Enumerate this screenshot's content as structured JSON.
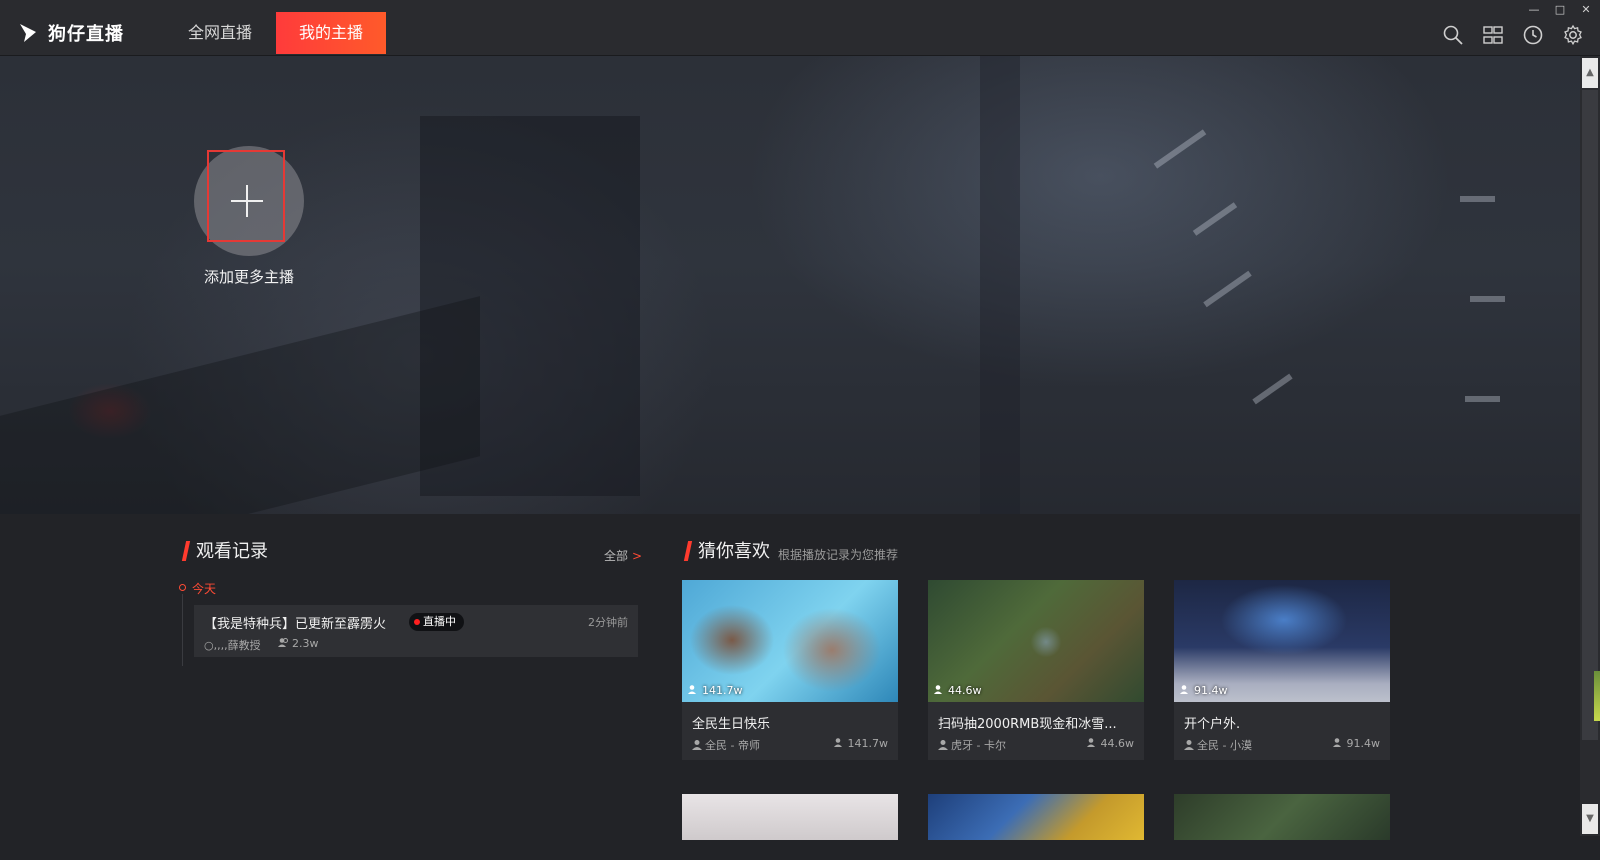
{
  "app": {
    "name": "狗仔直播"
  },
  "nav": {
    "tabs": [
      "全网直播",
      "我的主播"
    ],
    "active_index": 1
  },
  "window_controls": {
    "minimize": "—",
    "maximize": "□",
    "close": "✕"
  },
  "toolbar": {
    "icons": [
      "search-icon",
      "grid-icon",
      "clock-icon",
      "gear-icon"
    ]
  },
  "hero": {
    "add_label": "添加更多主播"
  },
  "history": {
    "title": "观看记录",
    "all_link": "全部",
    "all_arrow": ">",
    "day_label": "今天",
    "items": [
      {
        "title": "【我是特种兵】已更新至霹雳火",
        "badge": "直播中",
        "time": "2分钟前",
        "user": "○,,,,薛教授",
        "views": "2.3w"
      }
    ]
  },
  "recommend": {
    "title": "猜你喜欢",
    "subtitle": "根据播放记录为您推荐",
    "cards": [
      {
        "thumb_views": "141.7w",
        "title": "全民生日快乐",
        "meta": "全民 - 帝师",
        "count": "141.7w"
      },
      {
        "thumb_views": "44.6w",
        "title": "扫码抽2000RMB现金和冰雪...",
        "meta": "虎牙 - 卡尔",
        "count": "44.6w"
      },
      {
        "thumb_views": "91.4w",
        "title": "开个户外.",
        "meta": "全民 - 小漠",
        "count": "91.4w"
      }
    ]
  },
  "colors": {
    "accent": "#ff3b2e",
    "live_dot": "#ff2020",
    "bg": "#222327",
    "titlebar": "#2a2b2f"
  }
}
